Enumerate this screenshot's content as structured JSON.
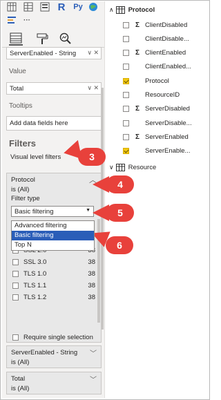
{
  "toolbar": {
    "icons_row1": [
      "table-matrix-icon",
      "table-icon",
      "slicer-icon",
      "r-visual-icon",
      "python-visual-icon",
      "globe-icon"
    ],
    "r_label": "R",
    "py_label": "Py",
    "more_label": "···",
    "tabs": [
      "fields-tab-icon",
      "format-paintroller-icon",
      "analytics-magnifier-icon"
    ]
  },
  "wells": {
    "field_chip": "ServerEnabled - String",
    "value_label": "Value",
    "value_chip": "Total",
    "tooltips_label": "Tooltips",
    "tooltips_placeholder": "Add data fields here"
  },
  "filters": {
    "heading": "Filters",
    "visual_level_label": "Visual level filters",
    "protocol_card": {
      "title": "Protocol",
      "subtitle": "is (All)",
      "filter_type_label": "Filter type",
      "selected": "Basic filtering",
      "options": [
        "Advanced filtering",
        "Basic filtering",
        "Top N"
      ],
      "items": [
        {
          "label": "SSL 2.0",
          "count": "38"
        },
        {
          "label": "SSL 3.0",
          "count": "38"
        },
        {
          "label": "TLS 1.0",
          "count": "38"
        },
        {
          "label": "TLS 1.1",
          "count": "38"
        },
        {
          "label": "TLS 1.2",
          "count": "38"
        }
      ],
      "require_single": "Require single selection"
    },
    "card2": {
      "title": "ServerEnabled - String",
      "subtitle": "is (All)"
    },
    "card3": {
      "title": "Total",
      "subtitle": "is (All)"
    }
  },
  "fields": {
    "protocol_table": "Protocol",
    "protocol_fields": [
      {
        "label": "ClientDisabled",
        "sigma": true,
        "checked": false
      },
      {
        "label": "ClientDisable...",
        "sigma": false,
        "checked": false
      },
      {
        "label": "ClientEnabled",
        "sigma": true,
        "checked": false
      },
      {
        "label": "ClientEnabled...",
        "sigma": false,
        "checked": false
      },
      {
        "label": "Protocol",
        "sigma": false,
        "checked": true
      },
      {
        "label": "ResourceID",
        "sigma": false,
        "checked": false
      },
      {
        "label": "ServerDisabled",
        "sigma": true,
        "checked": false
      },
      {
        "label": "ServerDisable...",
        "sigma": false,
        "checked": false
      },
      {
        "label": "ServerEnabled",
        "sigma": true,
        "checked": false
      },
      {
        "label": "ServerEnable...",
        "sigma": false,
        "checked": true
      }
    ],
    "resource_table": "Resource"
  },
  "callouts": [
    "3",
    "4",
    "5",
    "6"
  ],
  "colors": {
    "callout": "#e8413b",
    "selected_option": "#2b5eb8",
    "checkbox_checked": "#f2c811"
  }
}
